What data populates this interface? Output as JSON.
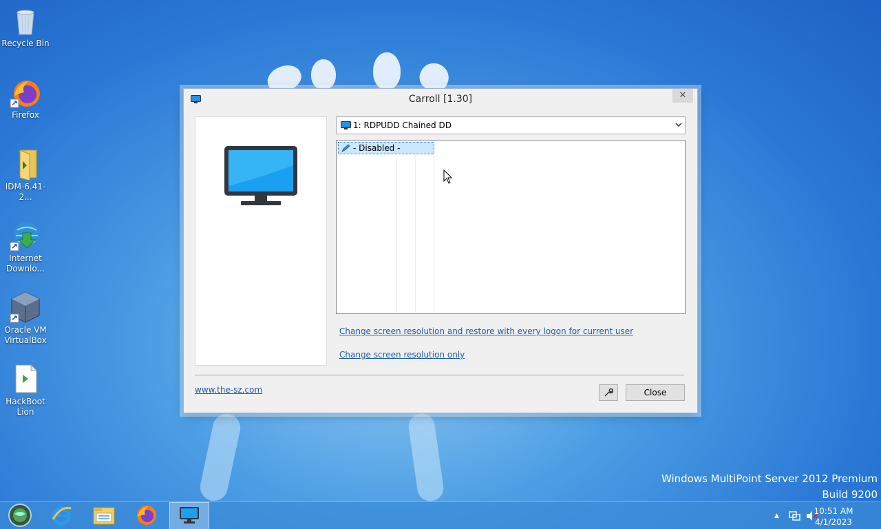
{
  "desktop": {
    "icons": [
      {
        "label": "Recycle Bin",
        "icon": "recycle-bin-icon"
      },
      {
        "label": "Firefox",
        "icon": "firefox-icon"
      },
      {
        "label": "IDM-6.41-2...",
        "icon": "folder-icon"
      },
      {
        "label_line1": "Internet",
        "label_line2": "Downlo...",
        "icon": "internet-download-manager-icon"
      },
      {
        "label_line1": "Oracle VM",
        "label_line2": "VirtualBox",
        "icon": "virtualbox-icon"
      },
      {
        "label_line1": "HackBoot",
        "label_line2": "Lion",
        "icon": "document-icon"
      }
    ],
    "watermark_line1": "Windows MultiPoint Server 2012 Premium",
    "watermark_line2": "Build 9200"
  },
  "window": {
    "title": "Carroll [1.30]",
    "close_glyph": "✕",
    "display_select": "1: RDPUDD Chained DD",
    "list_items": [
      "- Disabled -"
    ],
    "link_restore": "Change screen resolution and restore with every logon for current user",
    "link_only": "Change screen resolution only",
    "website": "www.the-sz.com",
    "close_label": "Close",
    "settings_glyph": "🔧"
  },
  "taskbar": {
    "clock_time": "10:51 AM",
    "clock_date": "4/1/2023",
    "tray_arrow": "▲",
    "accent": "#3c8cd7"
  }
}
